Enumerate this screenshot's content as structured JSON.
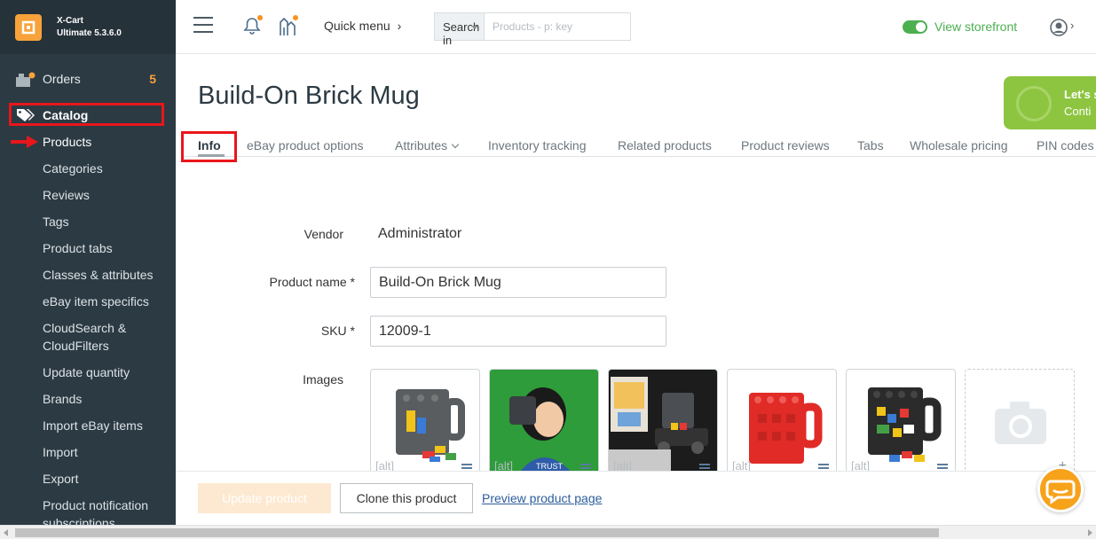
{
  "brand": {
    "name": "X-Cart",
    "version": "Ultimate 5.3.6.0"
  },
  "sidebar": {
    "orders": {
      "label": "Orders",
      "count": "5"
    },
    "catalog": {
      "label": "Catalog"
    },
    "items": [
      {
        "label": "Products"
      },
      {
        "label": "Categories"
      },
      {
        "label": "Reviews"
      },
      {
        "label": "Tags"
      },
      {
        "label": "Product tabs"
      },
      {
        "label": "Classes & attributes"
      },
      {
        "label": "eBay item specifics"
      },
      {
        "label": "CloudSearch & CloudFilters"
      },
      {
        "label": "Update quantity"
      },
      {
        "label": "Brands"
      },
      {
        "label": "Import eBay items"
      },
      {
        "label": "Import"
      },
      {
        "label": "Export"
      },
      {
        "label": "Product notification subscriptions"
      }
    ]
  },
  "topbar": {
    "quick_menu": "Quick menu",
    "search_scope": "Search in",
    "search_placeholder": "Products - p: key",
    "view_storefront": "View storefront",
    "user_chevron": "›",
    "quick_chevron": "›"
  },
  "page": {
    "title": "Build-On Brick Mug"
  },
  "promo": {
    "line1": "Let's s",
    "line2": "Conti"
  },
  "tabs": [
    {
      "label": "Info"
    },
    {
      "label": "eBay product options"
    },
    {
      "label": "Attributes"
    },
    {
      "label": "Inventory tracking"
    },
    {
      "label": "Related products"
    },
    {
      "label": "Product reviews"
    },
    {
      "label": "Tabs"
    },
    {
      "label": "Wholesale pricing"
    },
    {
      "label": "PIN codes"
    }
  ],
  "form": {
    "vendor_label": "Vendor",
    "vendor_value": "Administrator",
    "name_label": "Product name *",
    "name_value": "Build-On Brick Mug",
    "sku_label": "SKU *",
    "sku_value": "12009-1",
    "images_label": "Images",
    "images": [
      {
        "alt": "[alt]",
        "kind": "gray-mug"
      },
      {
        "alt": "[alt]",
        "kind": "person-mug"
      },
      {
        "alt": "[alt]",
        "kind": "mug-laptop"
      },
      {
        "alt": "[alt]",
        "kind": "red-mug"
      },
      {
        "alt": "[alt]",
        "kind": "black-mug"
      }
    ]
  },
  "actions": {
    "update": "Update product",
    "clone": "Clone this product",
    "preview": "Preview product page"
  },
  "colors": {
    "accent": "#f7a23a",
    "highlight": "#e8161b",
    "sidebar": "#2c3a43",
    "green": "#4caf50"
  }
}
